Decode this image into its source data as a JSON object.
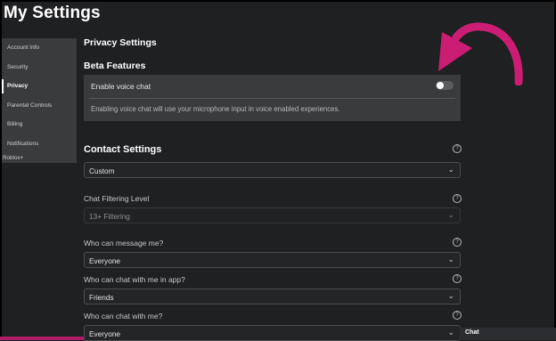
{
  "page_title": "My Settings",
  "sidebar": {
    "items": [
      {
        "label": "Account Info",
        "active": false
      },
      {
        "label": "Security",
        "active": false
      },
      {
        "label": "Privacy",
        "active": true
      },
      {
        "label": "Parental Controls",
        "active": false
      },
      {
        "label": "Billing",
        "active": false
      },
      {
        "label": "Notifications",
        "active": false
      }
    ],
    "extra": "Roblox+"
  },
  "privacy": {
    "title": "Privacy Settings",
    "beta": {
      "title": "Beta Features",
      "voice_label": "Enable voice chat",
      "voice_enabled": false,
      "description": "Enabling voice chat will use your microphone input in voice enabled experiences."
    }
  },
  "contact": {
    "title": "Contact Settings",
    "help_icon": "?",
    "value": "Custom"
  },
  "fields": [
    {
      "label": "Chat Filtering Level",
      "value": "13+ Filtering",
      "disabled": true
    },
    {
      "label": "Who can message me?",
      "value": "Everyone",
      "disabled": false
    },
    {
      "label": "Who can chat with me in app?",
      "value": "Friends",
      "disabled": false
    },
    {
      "label": "Who can chat with me?",
      "value": "Everyone",
      "disabled": false
    }
  ],
  "chevron_glyph": "⌄",
  "chat": {
    "label": "Chat"
  },
  "colors": {
    "arrow": "#cc1d74",
    "accent_border": "#b01a66",
    "panel": "#393b3d",
    "background": "#1f2022"
  },
  "icons": {
    "arrow": "curved-arrow-icon",
    "help": "help-circle-icon",
    "chevron": "chevron-down-icon"
  }
}
